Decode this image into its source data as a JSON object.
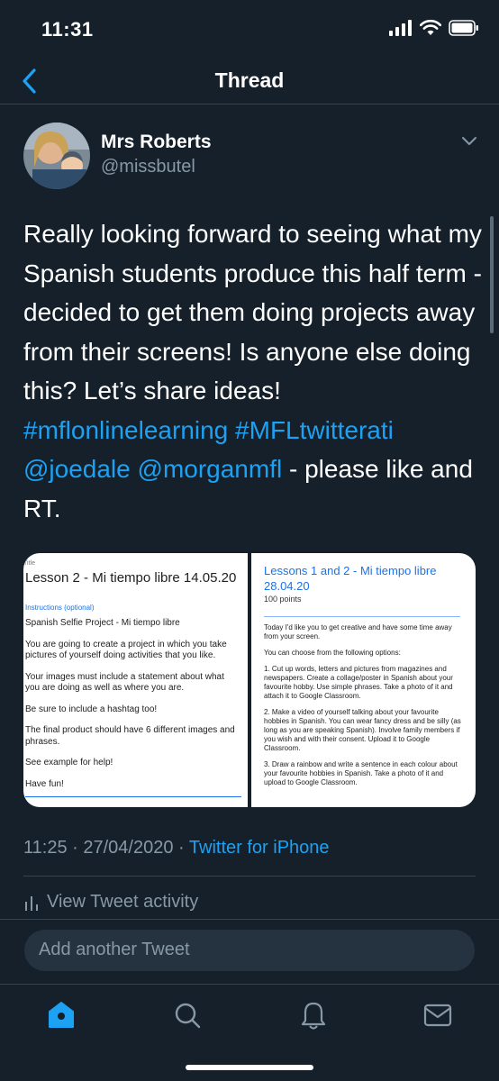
{
  "status": {
    "time": "11:31"
  },
  "nav": {
    "title": "Thread"
  },
  "author": {
    "name": "Mrs Roberts",
    "handle": "@missbutel"
  },
  "tweet": {
    "text_plain": "Really looking forward to seeing what my Spanish students produce this half term - decided to get them doing projects away from their screens! Is anyone else doing this? Let’s share ideas!",
    "hashtag1": "#mflonlinelearning",
    "hashtag2": "#MFLtwitterati",
    "mention1": "@joedale",
    "mention2": "@morganmfl",
    "text_end": "- please like and RT."
  },
  "media": {
    "left": {
      "tiny_label": "Title",
      "title": "Lesson 2 - Mi tiempo libre 14.05.20",
      "instructions_label": "Instructions (optional)",
      "body": [
        "Spanish Selfie Project  - Mi tiempo libre",
        "You are going to create a project in which you take pictures of yourself doing activities that you like.",
        "Your images must include a statement about what you are doing as well as where you are.",
        "Be sure to include a hashtag too!",
        "The final product should have 6 different images and phrases.",
        "See example for help!",
        "Have fun!"
      ]
    },
    "right": {
      "title": "Lessons 1 and 2 - Mi tiempo libre 28.04.20",
      "points": "100 points",
      "body": [
        "Today I'd like you to get creative and have some time away from your screen.",
        "You can choose from the following options:",
        "1. Cut up words, letters and pictures from magazines and newspapers. Create a collage/poster in Spanish about your favourite hobby. Use simple phrases. Take a photo of it and attach it to Google Classroom.",
        "2. Make a video of yourself talking about your favourite hobbies in Spanish. You can wear fancy dress and be silly (as long as you are speaking Spanish). Involve family members if you wish and with their consent. Upload it to Google Classroom.",
        "3. Draw a rainbow and write a sentence in each colour about your favourite hobbies in Spanish. Take a photo of it and upload to Google Classroom."
      ]
    }
  },
  "meta": {
    "time": "11:25",
    "date": "27/04/2020",
    "dot": "·",
    "source": "Twitter for iPhone"
  },
  "activity": {
    "label": "View Tweet activity"
  },
  "compose": {
    "placeholder": "Add another Tweet"
  },
  "colors": {
    "background": "#15202b",
    "accent": "#1da1f2",
    "muted": "#8899a6",
    "divider": "#38444d"
  },
  "icons": {
    "back": "chevron-left-icon",
    "more": "chevron-down-icon",
    "activity": "bar-chart-icon",
    "tab_home": "home-icon",
    "tab_search": "search-icon",
    "tab_notifications": "bell-icon",
    "tab_messages": "mail-icon"
  }
}
